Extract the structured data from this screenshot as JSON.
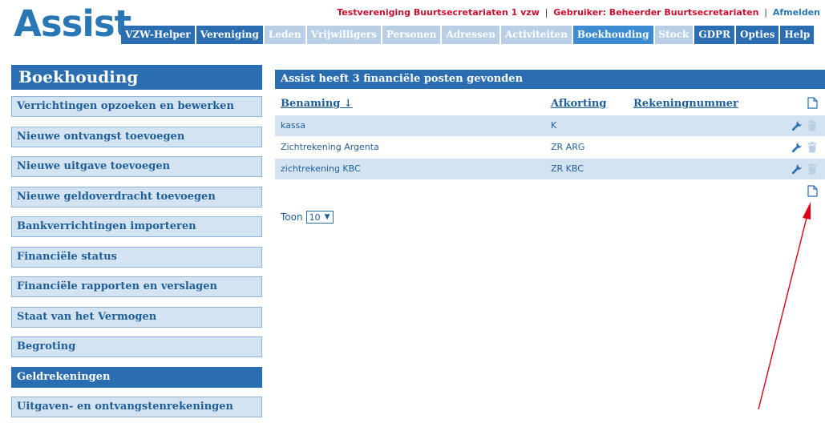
{
  "header": {
    "logo": "Assist",
    "org": "Testvereniging Buurtsecretariaten 1 vzw",
    "user": "Gebruiker: Beheerder Buurtsecretariaten",
    "logout": "Afmelden",
    "separator": "|"
  },
  "nav": [
    {
      "label": "VZW-Helper",
      "state": "enabled"
    },
    {
      "label": "Vereniging",
      "state": "enabled"
    },
    {
      "label": "Leden",
      "state": "disabled"
    },
    {
      "label": "Vrijwilligers",
      "state": "disabled"
    },
    {
      "label": "Personen",
      "state": "disabled"
    },
    {
      "label": "Adressen",
      "state": "disabled"
    },
    {
      "label": "Activiteiten",
      "state": "disabled"
    },
    {
      "label": "Boekhouding",
      "state": "active"
    },
    {
      "label": "Stock",
      "state": "disabled"
    },
    {
      "label": "GDPR",
      "state": "enabled"
    },
    {
      "label": "Opties",
      "state": "enabled"
    },
    {
      "label": "Help",
      "state": "enabled"
    }
  ],
  "sidebar": {
    "title": "Boekhouding",
    "items": [
      {
        "label": "Verrichtingen opzoeken en bewerken"
      },
      {
        "label": "Nieuwe ontvangst toevoegen"
      },
      {
        "label": "Nieuwe uitgave toevoegen"
      },
      {
        "label": "Nieuwe geldoverdracht toevoegen"
      },
      {
        "label": "Bankverrichtingen importeren"
      },
      {
        "label": "Financiële status"
      },
      {
        "label": "Financiële rapporten en verslagen"
      },
      {
        "label": "Staat van het Vermogen"
      },
      {
        "label": "Begroting"
      },
      {
        "label": "Geldrekeningen",
        "active": true
      },
      {
        "label": "Uitgaven- en ontvangstenrekeningen"
      }
    ]
  },
  "main": {
    "heading": "Assist heeft 3 financiële posten gevonden",
    "columns": {
      "name": "Benaming ↓",
      "abbr": "Afkorting",
      "account": "Rekeningnummer"
    },
    "rows": [
      {
        "name": "kassa",
        "abbr": "K",
        "account": ""
      },
      {
        "name": "Zichtrekening Argenta",
        "abbr": "ZR ARG",
        "account": ""
      },
      {
        "name": "zichtrekening KBC",
        "abbr": "ZR KBC",
        "account": ""
      }
    ],
    "page_size": {
      "label": "Toon",
      "value": "10"
    }
  },
  "icons": {
    "new": "new-document-icon",
    "edit": "wrench-icon",
    "delete": "trash-icon",
    "chevron": "chevron-down-icon"
  },
  "colors": {
    "brand": "#2a77b6",
    "nav": "#2a6db0",
    "nav_disabled": "#b9cfe6",
    "row_alt": "#d3e3f2",
    "user_text": "#c8102e",
    "annotation_arrow": "#e0001a"
  }
}
